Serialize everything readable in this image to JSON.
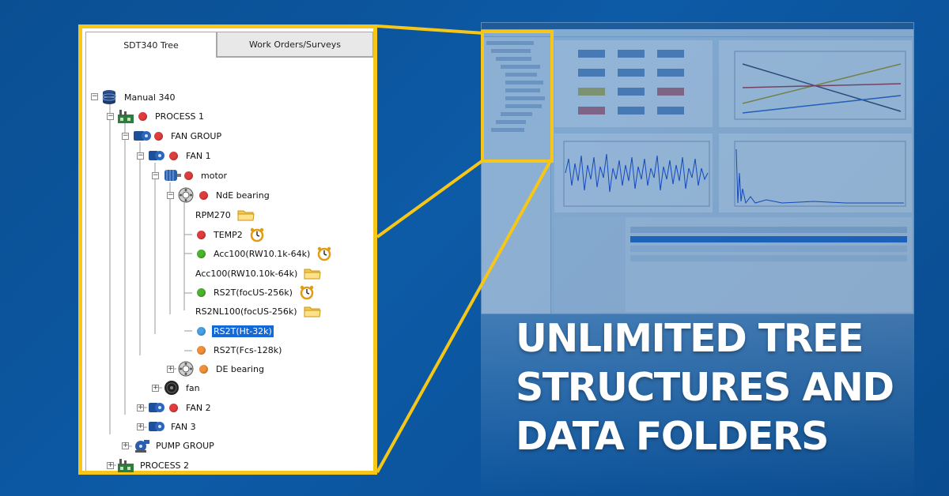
{
  "tabs": {
    "tree": "SDT340 Tree",
    "work_orders": "Work Orders/Surveys"
  },
  "tree": {
    "root": "Manual 340",
    "process1": "PROCESS 1",
    "fan_group": "FAN GROUP",
    "fan1": "FAN 1",
    "motor": "motor",
    "nde_bearing": "NdE bearing",
    "rpm270": "RPM270",
    "temp2": "TEMP2",
    "acc100_a": "Acc100(RW10.1k-64k)",
    "acc100_b": "Acc100(RW10.10k-64k)",
    "rs2t_focus": "RS2T(focUS-256k)",
    "rs2nl100": "RS2NL100(focUS-256k)",
    "rs2t_ht": "RS2T(Ht-32k)",
    "rs2t_fcs": "RS2T(Fcs-128k)",
    "de_bearing": "DE bearing",
    "fan": "fan",
    "fan2": "FAN 2",
    "fan3": "FAN 3",
    "pump_group": "PUMP GROUP",
    "process2": "PROCESS 2"
  },
  "headline": {
    "line1": "UNLIMITED TREE",
    "line2": "STRUCTURES AND",
    "line3": "DATA FOLDERS"
  },
  "colors": {
    "accent": "#f6c618",
    "selection": "#1569d6",
    "background": "#0d5aa6",
    "alarm_red": "#e03c3c",
    "ok_green": "#4cb32c",
    "info_blue": "#4aa0e0",
    "warn_orange": "#f0913a"
  }
}
